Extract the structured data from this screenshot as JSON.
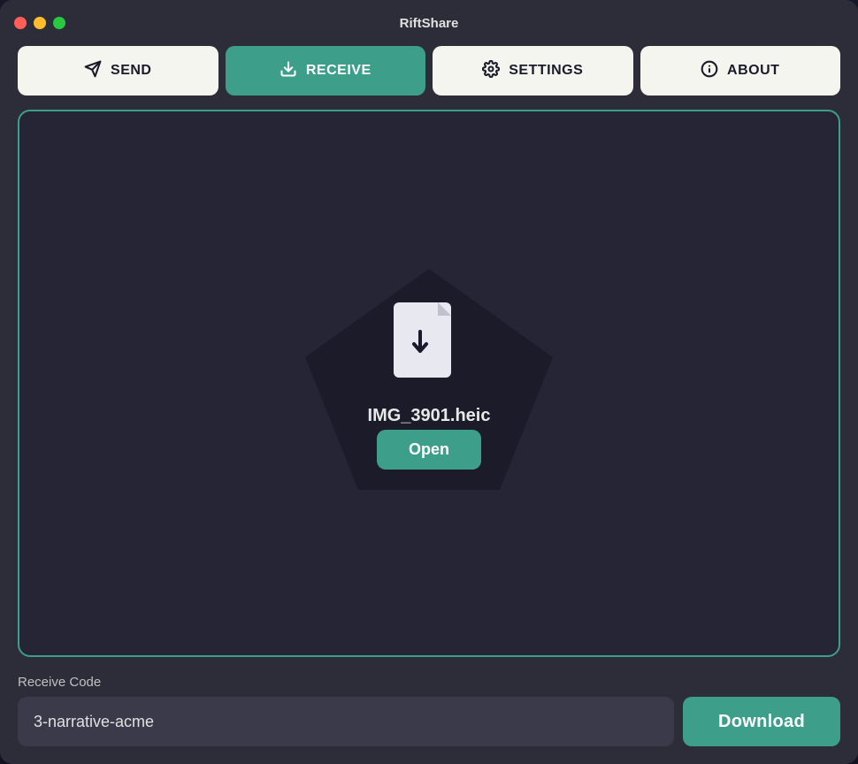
{
  "window": {
    "title": "RiftShare"
  },
  "nav": {
    "tabs": [
      {
        "id": "send",
        "label": "SEND",
        "icon": "✈",
        "active": false
      },
      {
        "id": "receive",
        "label": "RECEIVE",
        "icon": "⬇",
        "active": true
      },
      {
        "id": "settings",
        "label": "SETTINGS",
        "icon": "⚙",
        "active": false
      },
      {
        "id": "about",
        "label": "ABOUT",
        "icon": "ℹ",
        "active": false
      }
    ]
  },
  "receive": {
    "filename": "IMG_3901.heic",
    "open_label": "Open",
    "code_label": "Receive Code",
    "code_value": "3-narrative-acme",
    "code_placeholder": "3-narrative-acme",
    "download_label": "Download"
  },
  "colors": {
    "accent": "#3d9e8a",
    "background": "#2d2d3a",
    "card_bg": "#252535"
  }
}
